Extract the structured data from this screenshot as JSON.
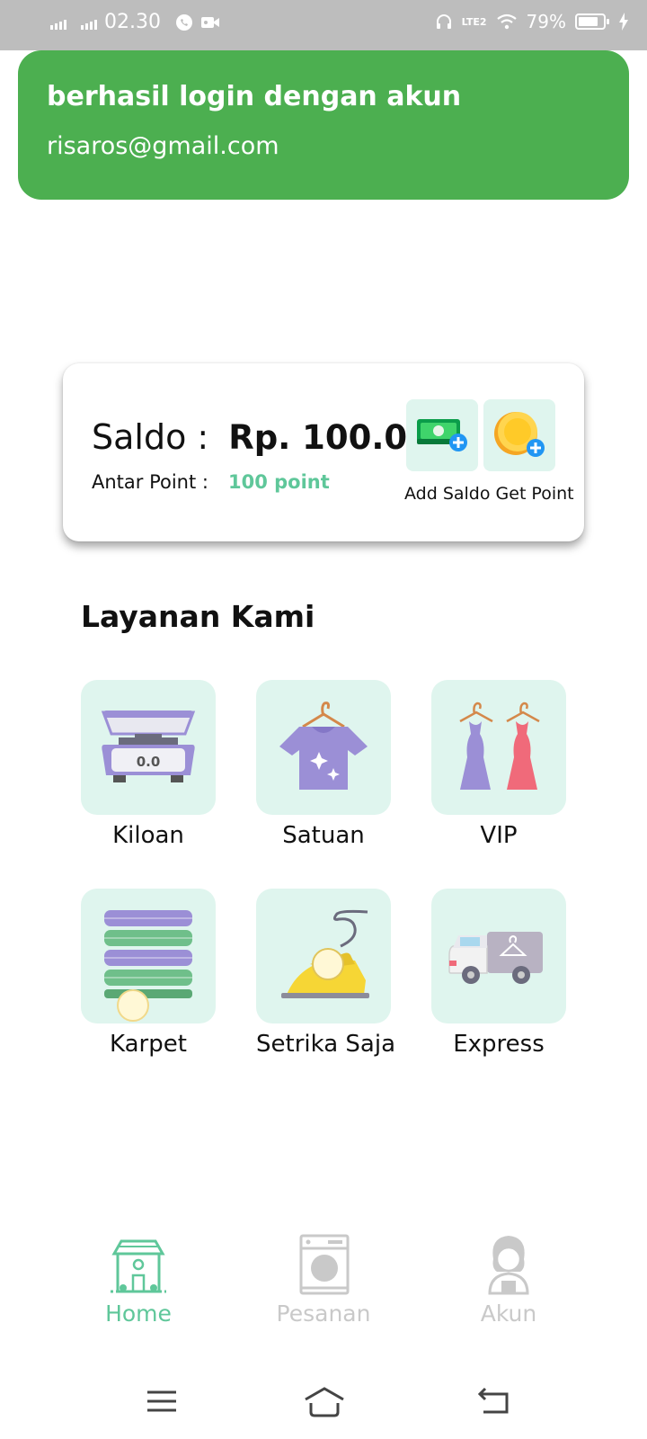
{
  "status_bar": {
    "time": "02.30",
    "network": "LTE2",
    "battery": "79%",
    "battery_level": 0.79
  },
  "toast": {
    "title": "berhasil login dengan akun",
    "email": "risaros@gmail.com",
    "color": "#4caf50"
  },
  "balance_card": {
    "saldo_label": "Saldo :",
    "saldo_value": "Rp. 100.000",
    "point_label": "Antar Point :",
    "point_value": "100 point",
    "actions_label": "Add Saldo Get Point",
    "add_saldo_icon": "money-add-icon",
    "get_point_icon": "coin-add-icon"
  },
  "services": {
    "title": "Layanan Kami",
    "items": [
      {
        "label": "Kiloan",
        "icon": "scale-icon",
        "scale_reading": "0.0"
      },
      {
        "label": "Satuan",
        "icon": "tshirt-hanger-icon"
      },
      {
        "label": "VIP",
        "icon": "dresses-icon"
      },
      {
        "label": "Karpet",
        "icon": "carpet-stack-icon"
      },
      {
        "label": "Setrika Saja",
        "icon": "iron-icon"
      },
      {
        "label": "Express",
        "icon": "delivery-truck-icon"
      }
    ]
  },
  "bottom_nav": {
    "items": [
      {
        "label": "Home",
        "icon": "home-icon",
        "active": true
      },
      {
        "label": "Pesanan",
        "icon": "washing-machine-icon",
        "active": false
      },
      {
        "label": "Akun",
        "icon": "user-avatar-icon",
        "active": false
      }
    ],
    "active_color": "#5fc79a",
    "inactive_color": "#c9c9c9"
  },
  "colors": {
    "accent": "#5fc79a",
    "tile_background": "#dff5ee"
  }
}
